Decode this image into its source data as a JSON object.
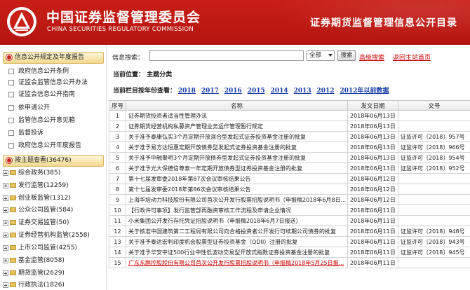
{
  "header": {
    "org_cn": "中国证券监督管理委员会",
    "org_en": "CHINA SECURITIES REGULATORY COMMISSION",
    "page_title": "证券期货监督管理信息公开目录"
  },
  "sidebar": {
    "section1": {
      "title": "信息公开规定及年度报告",
      "items": [
        "政府信息公开条例",
        "证监会监管信息公开办法",
        "证监会信息公开指南",
        "依申请公开",
        "监管信息公开意见箱",
        "监督投诉",
        "政府信息公开年度报告"
      ]
    },
    "section2": {
      "title": "按主题查看(36476)",
      "items": [
        "综合政务(385)",
        "发行监管(12259)",
        "创业板监管(1312)",
        "公众公司监管(584)",
        "证券交易监管(50)",
        "证券经营机构监管(2558)",
        "上市公司监管(4255)",
        "基金监管(8058)",
        "期货监管(2629)",
        "行政执法(1826)"
      ]
    }
  },
  "search": {
    "label": "信息搜索：",
    "placeholder": "",
    "scope": "全部",
    "button": "搜索",
    "advanced": "高级搜索",
    "home": "返回主站首页"
  },
  "location": "当前位置： 主题分类",
  "years": {
    "label": "当前栏目按年份查看：",
    "list": [
      "2018",
      "2017",
      "2016",
      "2015",
      "2014",
      "2013",
      "2012",
      "2012年以前数据"
    ]
  },
  "table": {
    "headers": [
      "序号",
      "名称",
      "发文日期",
      "文号"
    ],
    "rows": [
      [
        "1",
        "证券期货投资者适当性管理办法",
        "2018年06月13日",
        ""
      ],
      [
        "2",
        "证券期货经营机构私募资产管理业务运作管理暂行规定",
        "2018年06月13日",
        ""
      ],
      [
        "3",
        "关于准予泰康弘实3个月定期开放混合型发起式证券投资基金注册的批复",
        "2018年06月13日",
        "证监许可〔2018〕957号"
      ],
      [
        "4",
        "关于准予易方达恒惠定期开放债券型发起式证券投资基金注册的批复",
        "2018年06月13日",
        "证监许可〔2018〕966号"
      ],
      [
        "5",
        "关于准予中融聚明3个月定期开放债券型发起式证券投资基金注册的批复",
        "2018年06月13日",
        "证监许可〔2018〕954号"
      ],
      [
        "6",
        "关于准予光大保德信尊泰一年定期开放债券型证券投资基金注册的批复",
        "2018年06月13日",
        "证监许可〔2018〕952号"
      ],
      [
        "7",
        "第十七届发审委2018年第87次会议审核结果公告",
        "2018年06月12日",
        ""
      ],
      [
        "8",
        "第十七届发审委2018年第86次会议审核结果公告",
        "2018年06月12日",
        ""
      ],
      [
        "9",
        "上海华培动力科技股份有限公司首次公开发行股票招股说明书（申报稿2018年6月8日...",
        "2018年06月12日",
        ""
      ],
      [
        "10",
        "【行政许可事项】发行监管部再融资审核工作流程及申请企业情况",
        "2018年06月11日",
        ""
      ],
      [
        "11",
        "小米集团公开发行存托凭证招股说明书（申报稿2018年6月7日报送）",
        "2018年06月11日",
        ""
      ],
      [
        "12",
        "关于核准中国建筑第二工程局有限公司向合格投资者公开发行可续期公司债券的批复",
        "2018年06月11日",
        "证监许可〔2018〕948号"
      ],
      [
        "13",
        "关于准予泰达宏利印度机会股票型证券投资基金（QDII）注册的批复",
        "2018年06月11日",
        "证监许可〔2018〕943号"
      ],
      [
        "14",
        "关于准予华安中证500行业中性低波动交易型开放式指数证券投资基金注册的批复",
        "2018年06月11日",
        "证监许可〔2018〕945号"
      ],
      [
        "15",
        "广东东鹏控股股份有限公司首次公开发行股票招股说明书（申报稿2018年5月25日报...",
        "2018年06月11日",
        ""
      ]
    ]
  },
  "colors": {
    "brand_red": "#c81f17",
    "link_blue": "#1a3da8",
    "highlight_red": "#cc0000"
  }
}
